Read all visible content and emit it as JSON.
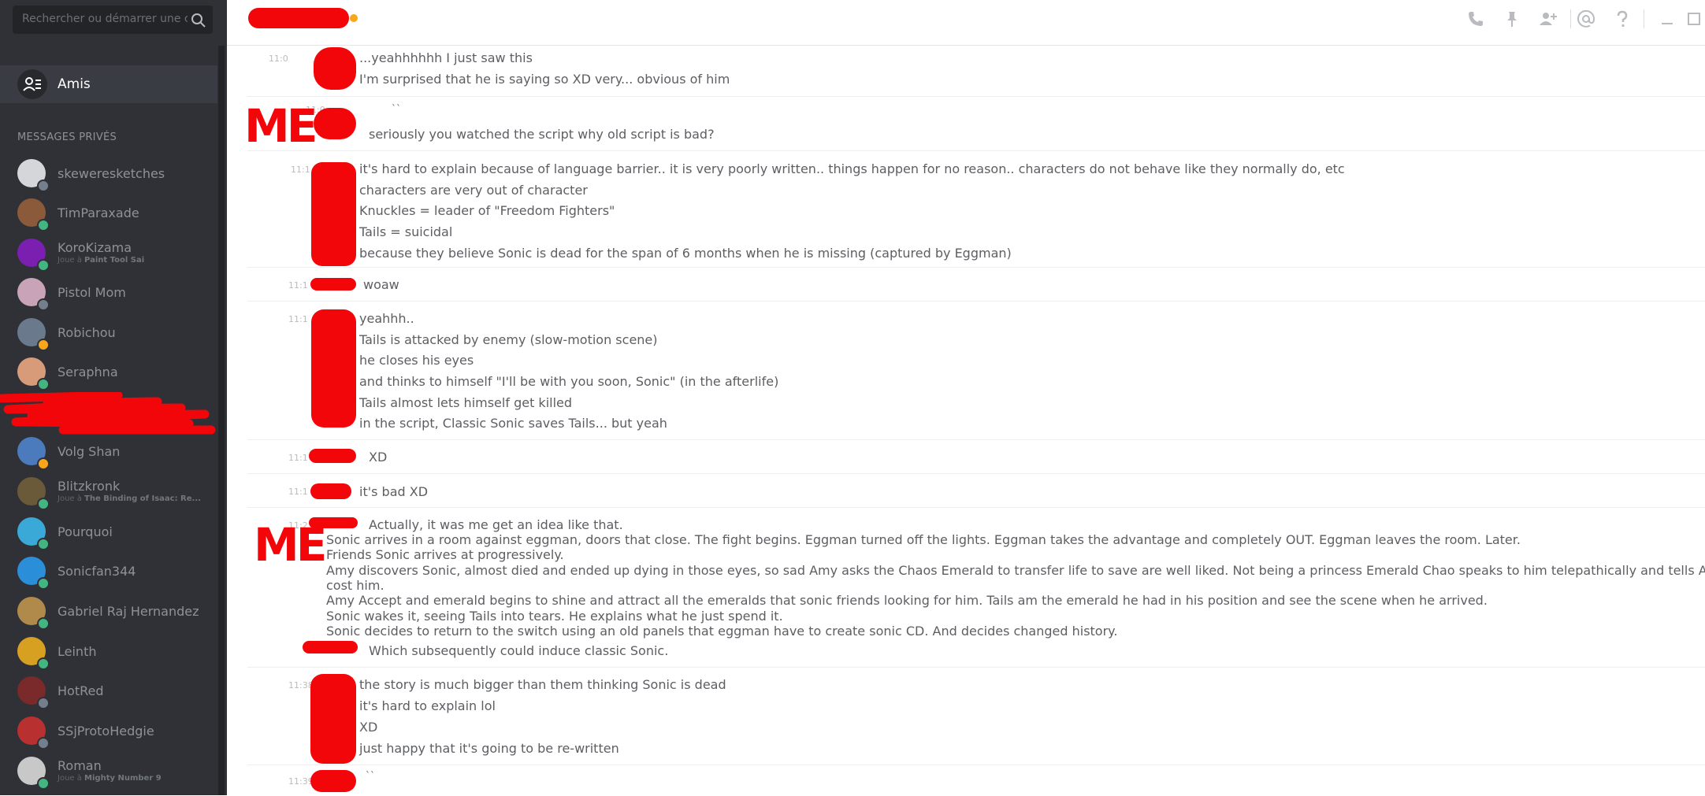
{
  "search": {
    "placeholder": "Rechercher ou démarrer une conversation"
  },
  "friends": {
    "label": "Amis"
  },
  "section_title": "MESSAGES PRIVÉS",
  "dms": [
    {
      "name": "skeweresketches",
      "sub": "",
      "game": "",
      "status": "offline",
      "color": "#d5d6da"
    },
    {
      "name": "TimParaxade",
      "sub": "",
      "game": "",
      "status": "online",
      "color": "#8a5a3a"
    },
    {
      "name": "KoroKizama",
      "sub": "Joue à ",
      "game": "Paint Tool Sai",
      "status": "online",
      "color": "#7a1fb0"
    },
    {
      "name": "Pistol Mom",
      "sub": "",
      "game": "",
      "status": "offline",
      "color": "#c9a4b8"
    },
    {
      "name": "Robichou",
      "sub": "",
      "game": "",
      "status": "idle",
      "color": "#6a7a8c"
    },
    {
      "name": "Seraphna",
      "sub": "",
      "game": "",
      "status": "online",
      "color": "#d89b7a"
    },
    {
      "name": "Volg Shan",
      "sub": "",
      "game": "",
      "status": "idle",
      "color": "#4c7bbd"
    },
    {
      "name": "Blitzkronk",
      "sub": "Joue à ",
      "game": "The Binding of Isaac: Re...",
      "status": "online",
      "color": "#6b5a3a"
    },
    {
      "name": "Pourquoi",
      "sub": "",
      "game": "",
      "status": "online",
      "color": "#3aa9d8"
    },
    {
      "name": "Sonicfan344",
      "sub": "",
      "game": "",
      "status": "online",
      "color": "#2a8fd8"
    },
    {
      "name": "Gabriel Raj Hernandez",
      "sub": "",
      "game": "",
      "status": "online",
      "color": "#b08a4a"
    },
    {
      "name": "Leinth",
      "sub": "",
      "game": "",
      "status": "online",
      "color": "#d8a020"
    },
    {
      "name": "HotRed",
      "sub": "",
      "game": "",
      "status": "offline",
      "color": "#7a2a2a"
    },
    {
      "name": "SSjProtoHedgie",
      "sub": "",
      "game": "",
      "status": "offline",
      "color": "#b83030"
    },
    {
      "name": "Roman",
      "sub": "Joue à ",
      "game": "Mighty Number 9",
      "status": "online",
      "color": "#c8c8c8"
    }
  ],
  "status_colors": {
    "online": "#43b581",
    "idle": "#faa61a",
    "offline": "#747f8d"
  },
  "header_icons": [
    "phone-icon",
    "pin-icon",
    "add-friend-icon",
    "mention-icon",
    "help-icon",
    "minimize-icon",
    "maximize-icon"
  ],
  "annotations": [
    "ME",
    "ME"
  ],
  "messages": {
    "g1": {
      "time": "11:0",
      "lines": [
        "...yeahhhhhh I just saw this",
        "I'm surprised that he is saying so XD very... obvious of him"
      ]
    },
    "g2": {
      "time": "11:0",
      "lines": [
        "``",
        "seriously you watched the script why old script is bad?"
      ]
    },
    "g3": {
      "time": "11:1",
      "lines": [
        "it's hard to explain because of language barrier.. it is very poorly written.. things happen for no reason.. characters do not behave like they normally do, etc",
        "characters are very out of character",
        "Knuckles = leader of \"Freedom Fighters\"",
        "Tails = suicidal",
        "because they believe Sonic is dead for the span of 6 months when he is missing (captured by Eggman)"
      ]
    },
    "g4": {
      "time": "11:1",
      "lines": [
        "woaw"
      ]
    },
    "g5": {
      "time": "11:1",
      "lines": [
        "yeahhh..",
        "Tails is attacked by enemy (slow-motion scene)",
        "he closes his eyes",
        "and thinks to himself \"I'll be with you soon, Sonic\" (in the afterlife)",
        "Tails almost lets himself get killed",
        "in the script, Classic Sonic saves Tails... but yeah"
      ]
    },
    "g6": {
      "time": "11:1",
      "lines": [
        "XD"
      ]
    },
    "g7": {
      "time": "11:1",
      "lines": [
        "it's bad XD"
      ]
    },
    "g8": {
      "time": "11:2",
      "lines": [
        "Actually, it was me get an idea like that.",
        "Sonic arrives in a room against eggman, doors that close. The fight begins. Eggman turned off the lights. Eggman takes the advantage and completely OUT. Eggman leaves the room. Later.",
        "Friends Sonic arrives at progressively.",
        "Amy discovers Sonic, almost died and ended up dying in those eyes, so sad Amy asks the Chaos Emerald to transfer life to save are well liked. Not being a princess Emerald Chao speaks to him telepathically and tells Amy that will",
        "cost him.",
        "Amy Accept and emerald begins to shine and attract all the emeralds that sonic friends looking for him. Tails am the emerald he had in his position and see the scene when he arrived.",
        "Sonic wakes it, seeing Tails into tears. He explains what he just spend it.",
        "Sonic decides to return to the switch using an old panels that eggman have to create sonic CD. And decides changed history.",
        "Which subsequently could induce classic Sonic."
      ]
    },
    "g9": {
      "time": "11:38",
      "lines": [
        "the story is much bigger than them thinking Sonic is dead",
        "it's hard to explain lol",
        "XD",
        "just happy that it's going to be re-written"
      ]
    },
    "g10": {
      "time": "11:39",
      "lines": [
        "``"
      ]
    }
  }
}
